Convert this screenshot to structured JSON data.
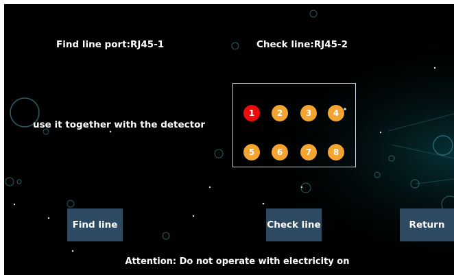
{
  "labels": {
    "find_port": "Find line port:RJ45-1",
    "check_line": "Check line:RJ45-2",
    "hint": "use it together with the detector",
    "attention": "Attention: Do not operate with electricity on"
  },
  "pins": [
    {
      "label": "1",
      "state": "active"
    },
    {
      "label": "2",
      "state": "idle"
    },
    {
      "label": "3",
      "state": "idle"
    },
    {
      "label": "4",
      "state": "idle"
    },
    {
      "label": "5",
      "state": "idle"
    },
    {
      "label": "6",
      "state": "idle"
    },
    {
      "label": "7",
      "state": "idle"
    },
    {
      "label": "8",
      "state": "idle"
    }
  ],
  "buttons": {
    "find_line": "Find line",
    "check_line": "Check line",
    "return": "Return"
  },
  "colors": {
    "background": "#000000",
    "pin_active": "#ef0b0b",
    "pin_idle": "#f4a431",
    "button": "#2e4a63",
    "panel_border": "#cfd6df"
  }
}
